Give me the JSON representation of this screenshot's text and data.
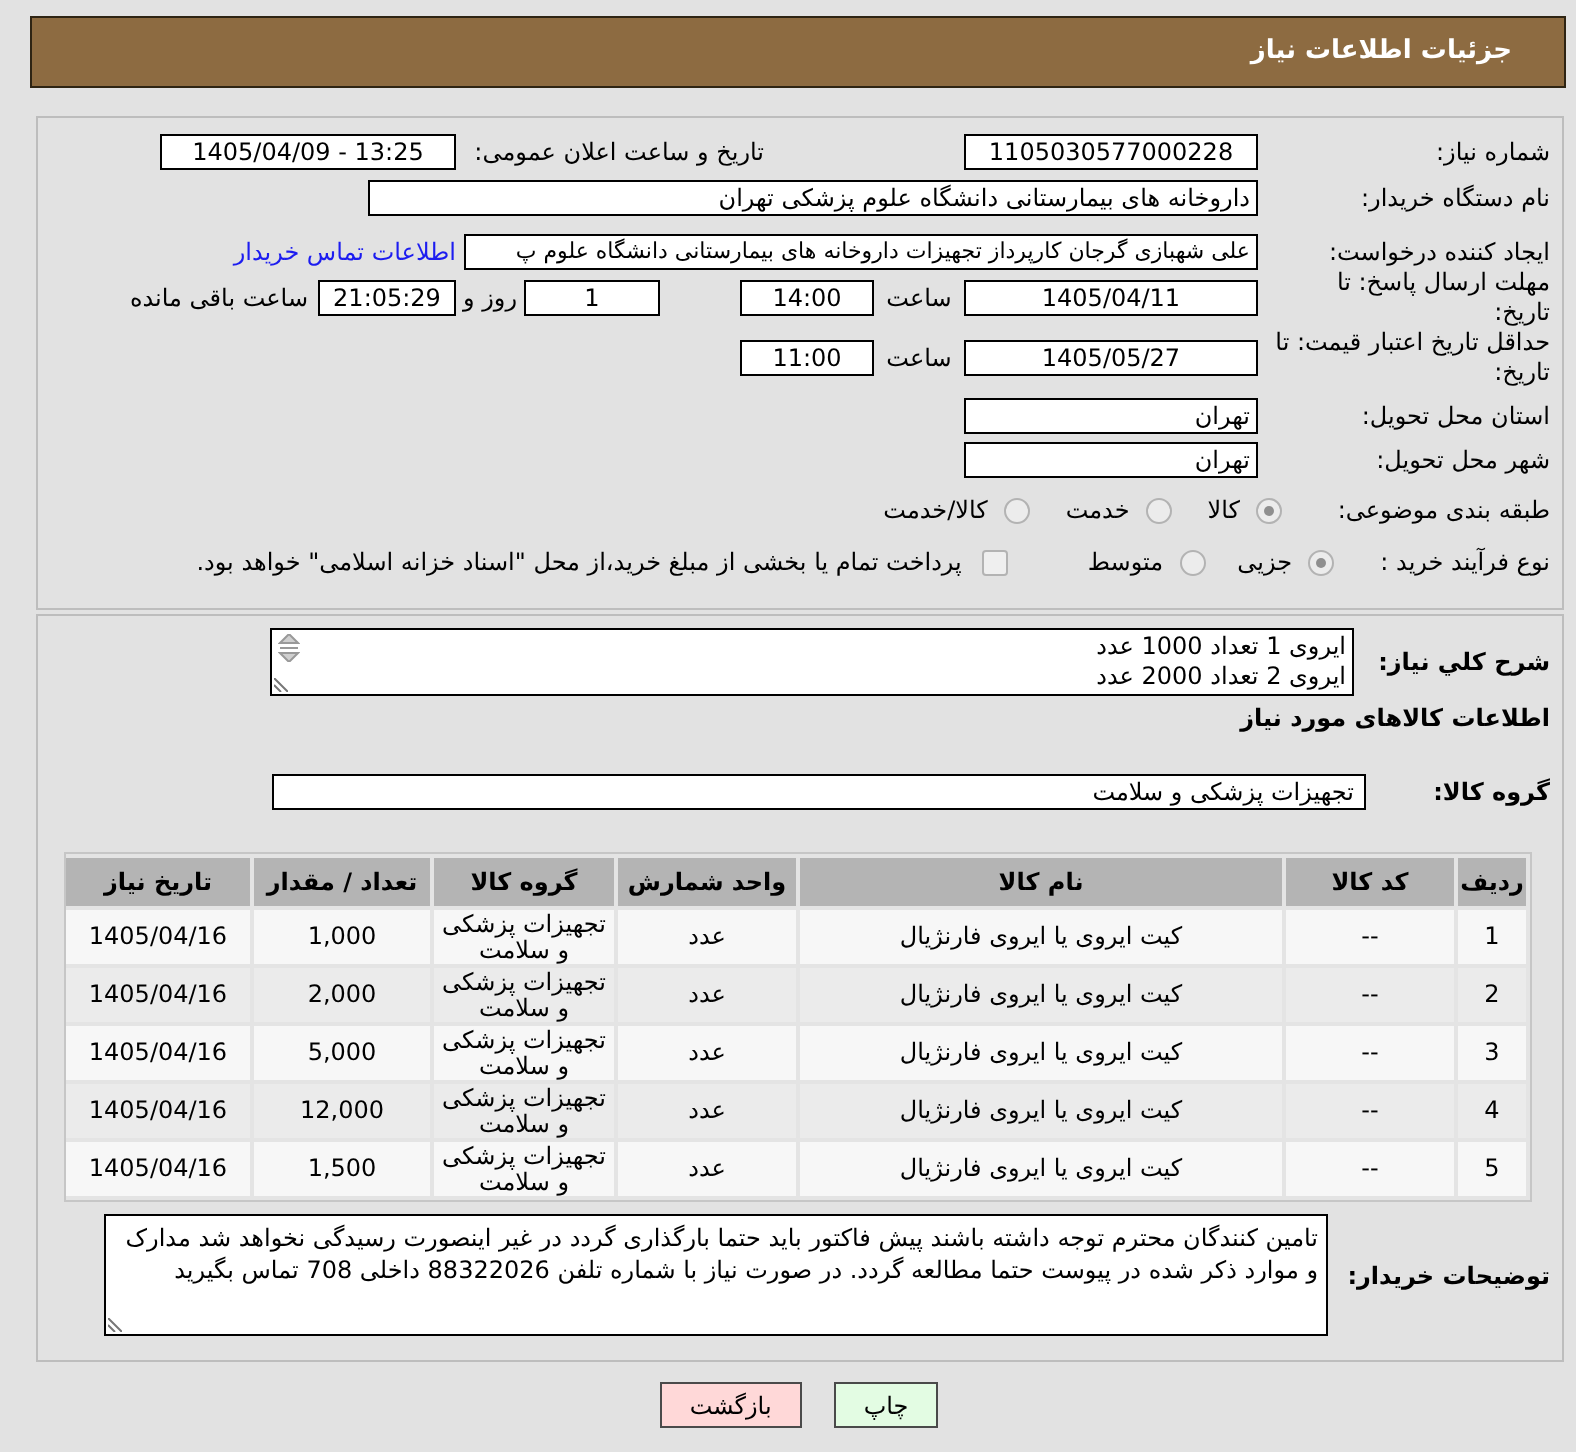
{
  "header": {
    "title": "جزئیات اطلاعات نیاز"
  },
  "details": {
    "need_number": {
      "label": "شماره نیاز:",
      "value": "1105030577000228"
    },
    "announce_datetime": {
      "label": "تاریخ و ساعت اعلان عمومی:",
      "value": "1405/04/09 - 13:25"
    },
    "buyer_org": {
      "label": "نام دستگاه خریدار:",
      "value": "داروخانه های بیمارستانی دانشگاه علوم پزشکی تهران"
    },
    "requester": {
      "label": "ایجاد کننده درخواست:",
      "value": "علی شهبازی گرجان کارپرداز تجهیزات داروخانه های بیمارستانی دانشگاه علوم پ",
      "contact_link": "اطلاعات تماس خریدار"
    },
    "response_deadline": {
      "label": "مهلت ارسال پاسخ: تا تاریخ:",
      "date": "1405/04/11",
      "time_label": "ساعت",
      "time": "14:00",
      "days": "1",
      "days_label": "روز و",
      "remaining": "21:05:29",
      "remaining_label": "ساعت باقی مانده"
    },
    "price_validity": {
      "label": "حداقل تاریخ اعتبار قیمت: تا تاریخ:",
      "date": "1405/05/27",
      "time_label": "ساعت",
      "time": "11:00"
    },
    "delivery_province": {
      "label": "استان محل تحویل:",
      "value": "تهران"
    },
    "delivery_city": {
      "label": "شهر محل تحویل:",
      "value": "تهران"
    },
    "subject_category": {
      "label": "طبقه بندی موضوعی:",
      "options": [
        {
          "label": "کالا",
          "selected": true
        },
        {
          "label": "خدمت",
          "selected": false
        },
        {
          "label": "کالا/خدمت",
          "selected": false
        }
      ]
    },
    "purchase_process": {
      "label": "نوع فرآیند خرید :",
      "options": [
        {
          "label": "جزیی",
          "selected": true
        },
        {
          "label": "متوسط",
          "selected": false
        }
      ],
      "treasury_payment": {
        "label": "پرداخت تمام یا بخشی از مبلغ خرید،از محل \"اسناد خزانه اسلامی\" خواهد بود.",
        "checked": false
      }
    }
  },
  "description": {
    "label": "شرح کلي نياز:",
    "lines": [
      "ایروی 1 تعداد 1000 عدد",
      "ایروی 2 تعداد 2000 عدد"
    ]
  },
  "goods": {
    "title": "اطلاعات کالاهای مورد نیاز",
    "group_label": "گروه کالا:",
    "group_value": "تجهیزات پزشکی و سلامت",
    "table": {
      "columns": [
        "ردیف",
        "کد کالا",
        "نام کالا",
        "واحد شمارش",
        "گروه کالا",
        "تعداد / مقدار",
        "تاریخ نیاز"
      ],
      "rows": [
        [
          "1",
          "--",
          "کیت ایروی یا ایروی فارنژیال",
          "عدد",
          "تجهیزات پزشکی و سلامت",
          "1,000",
          "1405/04/16"
        ],
        [
          "2",
          "--",
          "کیت ایروی یا ایروی فارنژیال",
          "عدد",
          "تجهیزات پزشکی و سلامت",
          "2,000",
          "1405/04/16"
        ],
        [
          "3",
          "--",
          "کیت ایروی یا ایروی فارنژیال",
          "عدد",
          "تجهیزات پزشکی و سلامت",
          "5,000",
          "1405/04/16"
        ],
        [
          "4",
          "--",
          "کیت ایروی یا ایروی فارنژیال",
          "عدد",
          "تجهیزات پزشکی و سلامت",
          "12,000",
          "1405/04/16"
        ],
        [
          "5",
          "--",
          "کیت ایروی یا ایروی فارنژیال",
          "عدد",
          "تجهیزات پزشکی و سلامت",
          "1,500",
          "1405/04/16"
        ]
      ]
    }
  },
  "buyer_notes": {
    "label": "توضیحات خریدار:",
    "text": "تامین کنندگان محترم توجه داشته باشند پیش فاکتور باید حتما بارگذاری گردد در غیر اینصورت رسیدگی نخواهد شد مدارک و موارد ذکر شده در پیوست حتما مطالعه گردد. در صورت نیاز با شماره تلفن 88322026 داخلی 708 تماس بگیرید"
  },
  "buttons": [
    {
      "label": "چاپ",
      "kind": "print"
    },
    {
      "label": "بازگشت",
      "kind": "back"
    }
  ]
}
